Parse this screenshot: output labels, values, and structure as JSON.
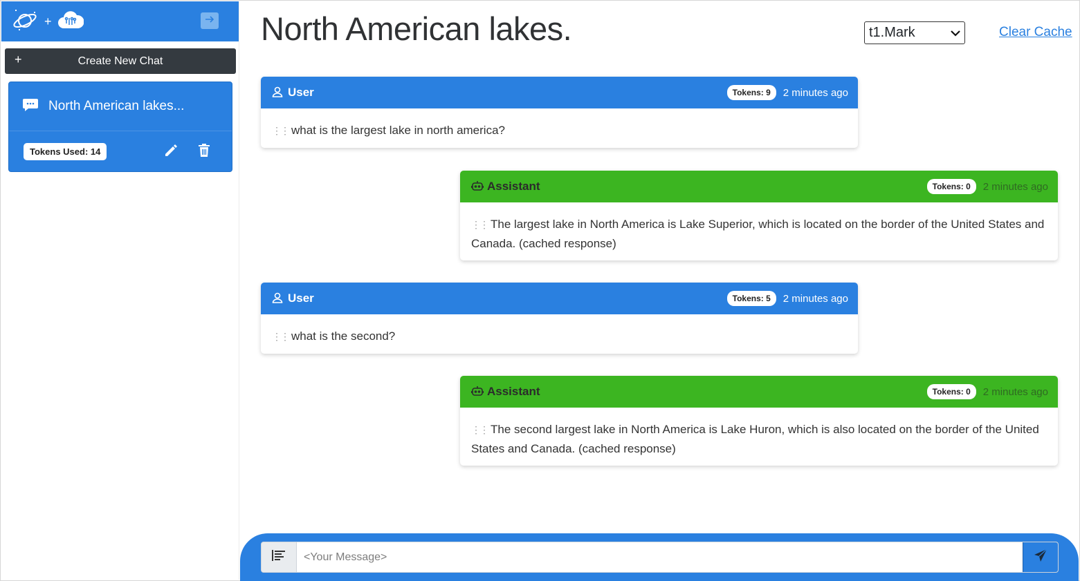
{
  "sidebar": {
    "logo_icons": [
      "planet-icon",
      "plus-icon",
      "cloud-brain-icon"
    ],
    "collapse_icon": "arrow-right-icon",
    "new_chat_label": "Create New Chat",
    "chats": [
      {
        "title": "North American lakes...",
        "tokens_used": "Tokens Used: 14",
        "icon": "chat-bubble-icon"
      }
    ]
  },
  "header": {
    "title": "North American lakes.",
    "model_select": {
      "value": "t1.Mark",
      "options": [
        "t1.Mark"
      ]
    },
    "clear_cache_label": "Clear Cache"
  },
  "messages": [
    {
      "role": "User",
      "tokens": "Tokens: 9",
      "time": "2 minutes ago",
      "text": "what is the largest lake in north america?"
    },
    {
      "role": "Assistant",
      "tokens": "Tokens: 0",
      "time": "2 minutes ago",
      "text": "The largest lake in North America is Lake Superior, which is located on the border of the United States and Canada. (cached response)"
    },
    {
      "role": "User",
      "tokens": "Tokens: 5",
      "time": "2 minutes ago",
      "text": "what is the second?"
    },
    {
      "role": "Assistant",
      "tokens": "Tokens: 0",
      "time": "2 minutes ago",
      "text": "The second largest lake in North America is Lake Huron, which is also located on the border of the United States and Canada. (cached response)"
    }
  ],
  "composer": {
    "placeholder": "<Your Message>",
    "value": ""
  },
  "colors": {
    "primary": "#2a80e0",
    "assistant": "#3cb521",
    "dark": "#343a40"
  }
}
